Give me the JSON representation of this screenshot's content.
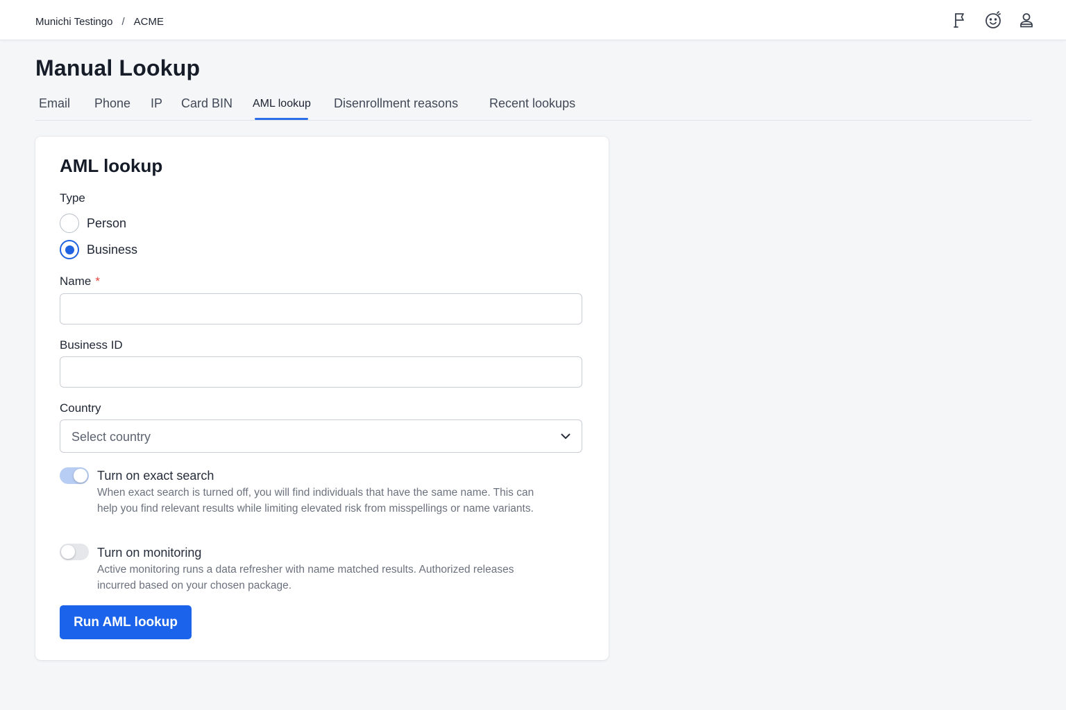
{
  "breadcrumb": {
    "org": "Munichi Testingo",
    "separator": "/",
    "current": "ACME"
  },
  "top_icons": [
    "flag-icon",
    "smiley-icon",
    "user-icon"
  ],
  "page": {
    "title": "Manual Lookup"
  },
  "tabs": [
    {
      "label": "Email"
    },
    {
      "label": "Phone"
    },
    {
      "label": "IP"
    },
    {
      "label": "Card BIN"
    },
    {
      "label": "AML lookup",
      "active": true
    },
    {
      "label": "Disenrollment reasons"
    },
    {
      "label": "Recent lookups"
    }
  ],
  "form": {
    "title": "AML lookup",
    "type_label": "Type",
    "type_options": [
      {
        "label": "Person",
        "selected": false
      },
      {
        "label": "Business",
        "selected": true
      }
    ],
    "name_label": "Name",
    "name_required_mark": "*",
    "name_value": "",
    "business_id_label": "Business ID",
    "business_id_value": "",
    "country_label": "Country",
    "country_placeholder": "Select country",
    "exact_search": {
      "title": "Turn on exact search",
      "on": true,
      "description": "When exact search is turned off, you will find individuals that have the same name. This can help you find relevant results while limiting elevated risk from misspellings or name variants."
    },
    "monitoring": {
      "title": "Turn on monitoring",
      "on": false,
      "description": "Active monitoring runs a data refresher with name matched results. Authorized releases incurred based on your chosen package."
    },
    "submit_label": "Run AML lookup"
  },
  "colors": {
    "accent": "#1b63ea",
    "required": "#e0443a",
    "toggle_on": "#b8cdf4",
    "toggle_off": "#e5e7eb"
  }
}
